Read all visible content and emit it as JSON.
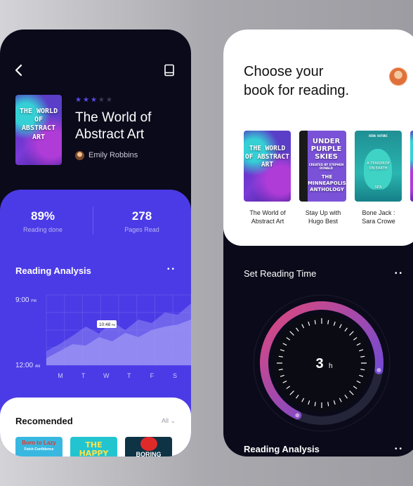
{
  "left": {
    "nav": {
      "back_icon": "chevron-left-icon",
      "library_icon": "book-icon"
    },
    "book": {
      "cover_title": "THE WORLD OF ABSTRACT ART",
      "rating": 3,
      "rating_max": 5,
      "title_line1": "The World of",
      "title_line2": "Abstract Art",
      "author": "Emily Robbins"
    },
    "stats": [
      {
        "value": "89%",
        "label": "Reading done"
      },
      {
        "value": "278",
        "label": "Pages Read"
      }
    ],
    "analysis": {
      "title": "Reading Analysis",
      "more_icon": "more-dots-icon",
      "y_top": "9:00",
      "y_top_unit": "PM",
      "y_bottom": "12:00",
      "y_bottom_unit": "AM",
      "tooltip": "10:48",
      "tooltip_unit": "PM",
      "chart_data": {
        "type": "area",
        "categories": [
          "M",
          "T",
          "W",
          "T",
          "F",
          "S"
        ],
        "series": [
          {
            "values": [
              0.2,
              0.3,
              0.42,
              0.55,
              0.45,
              0.62,
              0.5,
              0.65,
              0.6,
              0.75,
              0.72,
              0.88
            ]
          },
          {
            "values": [
              0.1,
              0.2,
              0.3,
              0.28,
              0.4,
              0.34,
              0.46,
              0.4,
              0.5,
              0.55,
              0.58,
              0.65
            ]
          }
        ],
        "colors": [
          "#8f86f2",
          "#a9a2f7"
        ]
      }
    },
    "recommended": {
      "title": "Recomended",
      "filter": "All",
      "books": [
        {
          "title": "Born to Lazy",
          "subtitle": "Fetch Confidence"
        },
        {
          "title": "THE HAPPY LESSON"
        },
        {
          "title": "BORING"
        }
      ]
    }
  },
  "right": {
    "header": {
      "line1": "Choose your",
      "line2": "book for reading."
    },
    "shelf": [
      {
        "cover_title": "THE WORLD OF ABSTRACT ART",
        "caption_line1": "The World of",
        "caption_line2": "Abstract Art"
      },
      {
        "cover_title": "UNDER PURPLE SKIES",
        "cover_sub": "CREATED BY STEPHEN DONALD",
        "cover_title2": "THE MINNEAPOLIS ANTHOLOGY",
        "caption_line1": "Stay Up with",
        "caption_line2": "Hugo Best"
      },
      {
        "cover_author": "NINA KATORI",
        "cover_title": "A TEARDROP ON EARTH",
        "cover_title2": "SEA",
        "caption_line1": "Bone Jack :",
        "caption_line2": "Sara Crowe"
      }
    ],
    "timer": {
      "title": "Set Reading Time",
      "value": "3",
      "unit": "h",
      "progress": 0.7
    },
    "footer_title": "Reading Analysis",
    "colors": {
      "accent": "#4b3be6",
      "ring_start": "#e0487a",
      "ring_end": "#5a4be8"
    }
  }
}
